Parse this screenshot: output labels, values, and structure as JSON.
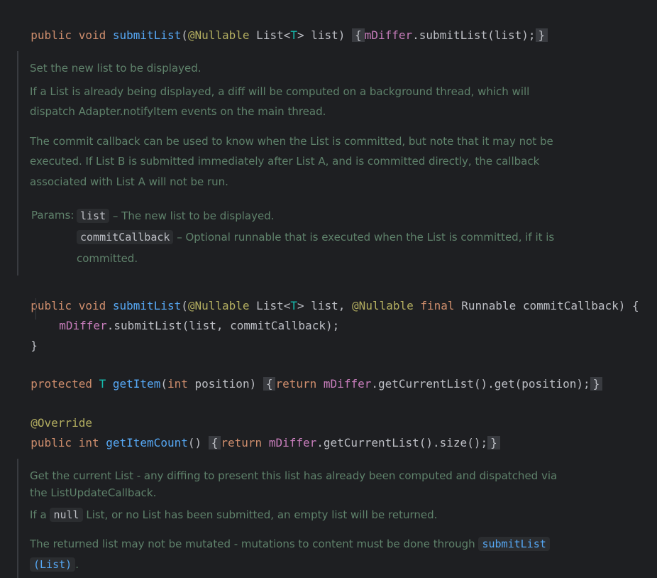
{
  "code": {
    "line1": {
      "pub": "public",
      "void": "void",
      "fn": "submitList",
      "open": "(",
      "ann": "@Nullable",
      "type": " List<",
      "tp": "T",
      "rest": "> list)",
      "fold_open": "{",
      "field": "mDiffer",
      "call": ".submitList(list);",
      "fold_close": "}"
    },
    "line2": {
      "pub": "public",
      "void": "void",
      "fn": "submitList",
      "open": "(",
      "ann1": "@Nullable",
      "type": " List<",
      "tp": "T",
      "mid": "> list, ",
      "ann2": "@Nullable",
      "final": "final",
      "rest": " Runnable commitCallback) {"
    },
    "line3": {
      "field": "mDiffer",
      "call": ".submitList(list, commitCallback);"
    },
    "line4": {
      "close": "}"
    },
    "line5": {
      "prot": "protected",
      "tp": "T",
      "fn": "getItem",
      "open": "(",
      "int": "int",
      "rest": " position)",
      "fold_open": "{",
      "ret": "return",
      "field": "mDiffer",
      "call": ".getCurrentList().get(position);",
      "fold_close": "}"
    },
    "line6": {
      "ann": "@Override"
    },
    "line7": {
      "pub": "public",
      "int": "int",
      "fn": "getItemCount",
      "paren": "()",
      "fold_open": "{",
      "ret": "return",
      "field": "mDiffer",
      "call": ".getCurrentList().size();",
      "fold_close": "}"
    }
  },
  "doc1": {
    "p1": "Set the new list to be displayed.",
    "p2a": "If a List is already being displayed, a diff will be computed on a background thread, which will",
    "p2b": "dispatch Adapter.notifyItem events on the main thread.",
    "p3a": "The commit callback can be used to know when the List is committed, but note that it may not be",
    "p3b": "executed. If List B is submitted immediately after List A, and is committed directly, the callback",
    "p3c": "associated with List A will not be run.",
    "params_label": "Params:",
    "param1_name": "list",
    "param1_desc": " – The new list to be displayed.",
    "param2_name": "commitCallback",
    "param2_desc": " – Optional runnable that is executed when the List is committed, if it is",
    "param2_desc2": "committed."
  },
  "doc2": {
    "p1a": "Get the current List - any diffing to present this list has already been computed and dispatched via",
    "p1b": "the ListUpdateCallback.",
    "p2_pre": "If a ",
    "p2_code": "null",
    "p2_post": " List, or no List has been submitted, an empty list will be returned.",
    "p3_pre": "The returned list may not be mutated - mutations to content must be done through ",
    "p3_link1": "submitList",
    "p3_link2": "(List)",
    "p3_post": "."
  }
}
